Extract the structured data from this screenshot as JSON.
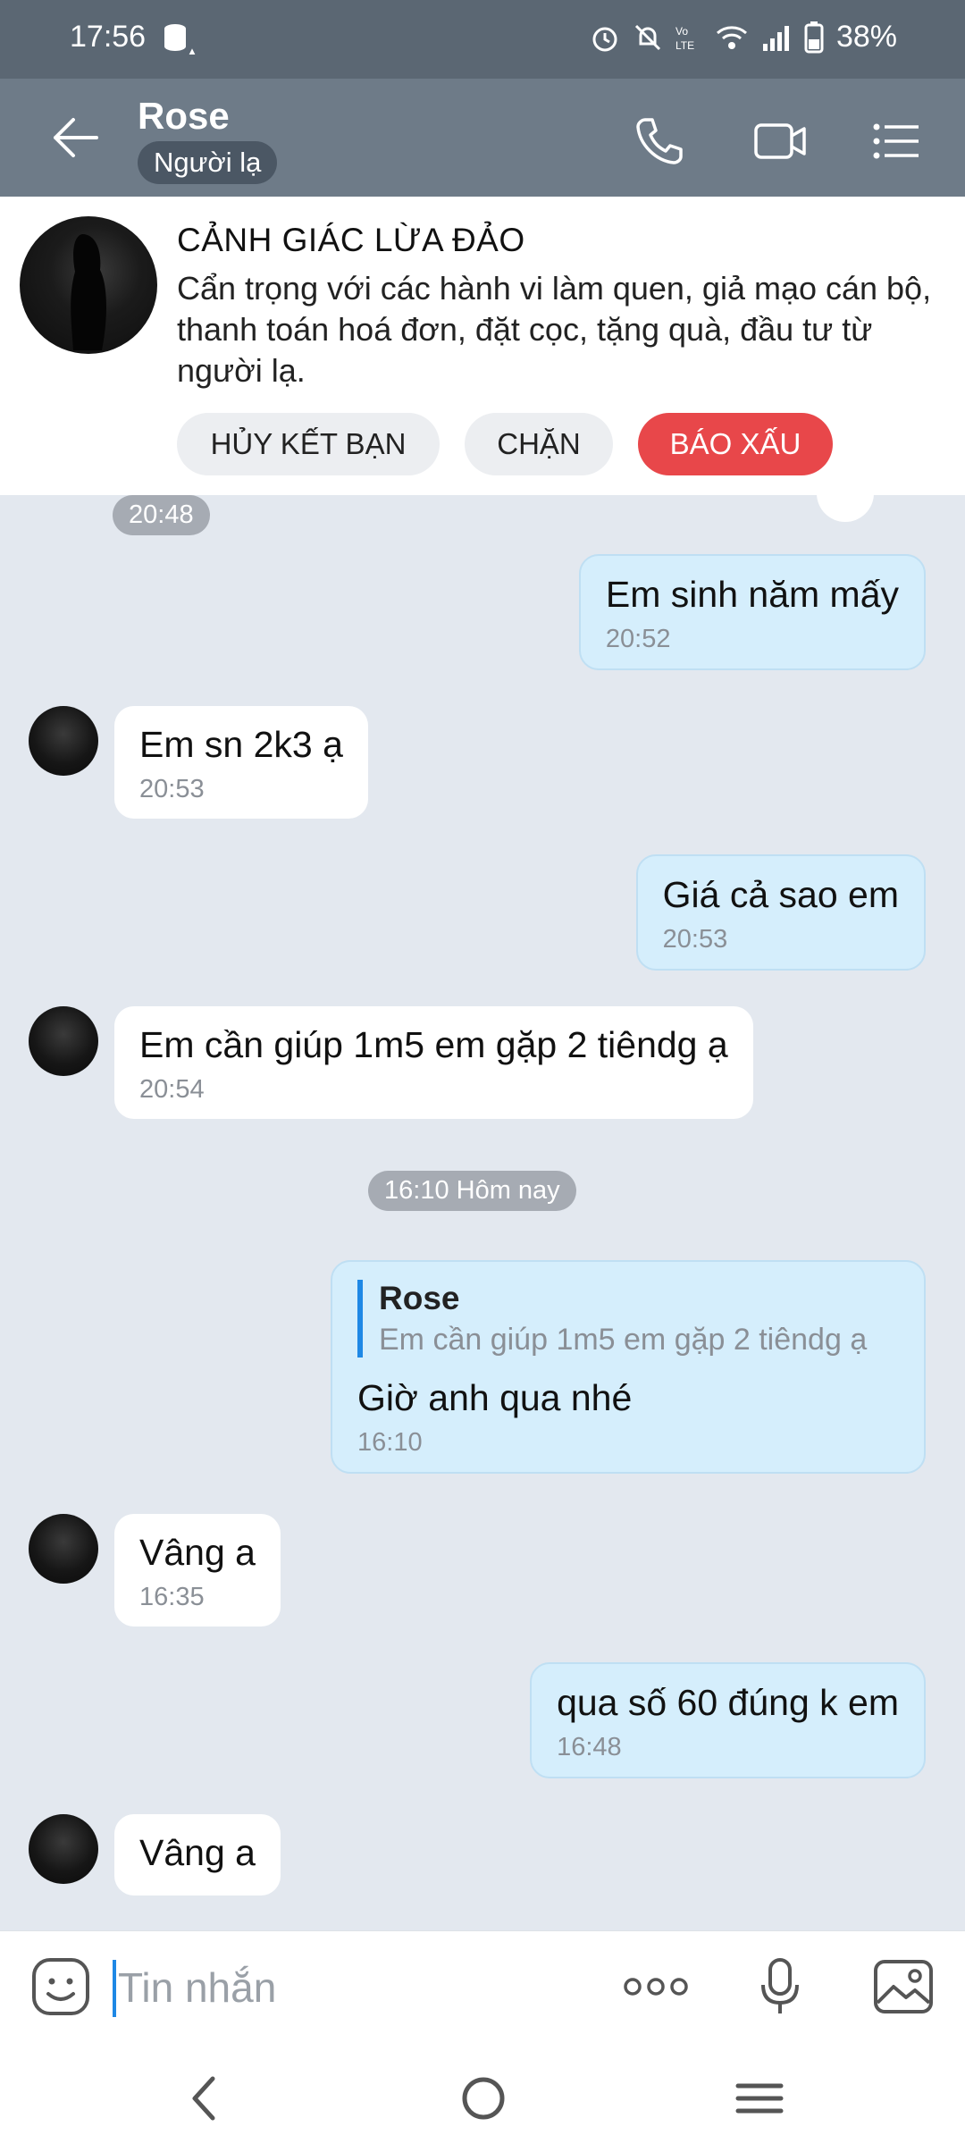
{
  "status_bar": {
    "time": "17:56",
    "battery": "38%"
  },
  "header": {
    "contact_name": "Rose",
    "contact_tag": "Người lạ"
  },
  "warning": {
    "title": "CẢNH GIÁC LỪA ĐẢO",
    "text": "Cẩn trọng với các hành vi làm quen, giả mạo cán bộ, thanh toán hoá đơn, đặt cọc, tặng quà, đầu tư từ người lạ.",
    "unfriend_label": "HỦY KẾT BẠN",
    "block_label": "CHẶN",
    "report_label": "BÁO XẤU"
  },
  "chat": {
    "top_time": "20:48",
    "separator": "16:10 Hôm nay",
    "messages": [
      {
        "dir": "out",
        "text": "Em sinh năm mấy",
        "time": "20:52"
      },
      {
        "dir": "in",
        "text": "Em sn 2k3 ạ",
        "time": "20:53"
      },
      {
        "dir": "out",
        "text": "Giá cả sao em",
        "time": "20:53"
      },
      {
        "dir": "in",
        "text": "Em cần giúp 1m5 em gặp 2 tiêndg ạ",
        "time": "20:54"
      },
      {
        "dir": "out",
        "quote_name": "Rose",
        "quote_text": "Em cần giúp 1m5 em gặp 2 tiêndg ạ",
        "text": "Giờ anh qua nhé",
        "time": "16:10"
      },
      {
        "dir": "in",
        "text": "Vâng a",
        "time": "16:35"
      },
      {
        "dir": "out",
        "text": "qua số 60 đúng k em",
        "time": "16:48"
      },
      {
        "dir": "in",
        "text": "Vâng a",
        "time": ""
      }
    ]
  },
  "input": {
    "placeholder": "Tin nhắn"
  },
  "colors": {
    "header": "#6e7b88",
    "status_bar": "#5b6773",
    "report": "#e8474a",
    "outgoing_bubble": "#d5eefc",
    "chat_bg": "#e3e8ef"
  },
  "icons": [
    "back-arrow-icon",
    "phone-icon",
    "video-call-icon",
    "menu-list-icon",
    "emoji-icon",
    "more-icon",
    "microphone-icon",
    "image-icon"
  ]
}
